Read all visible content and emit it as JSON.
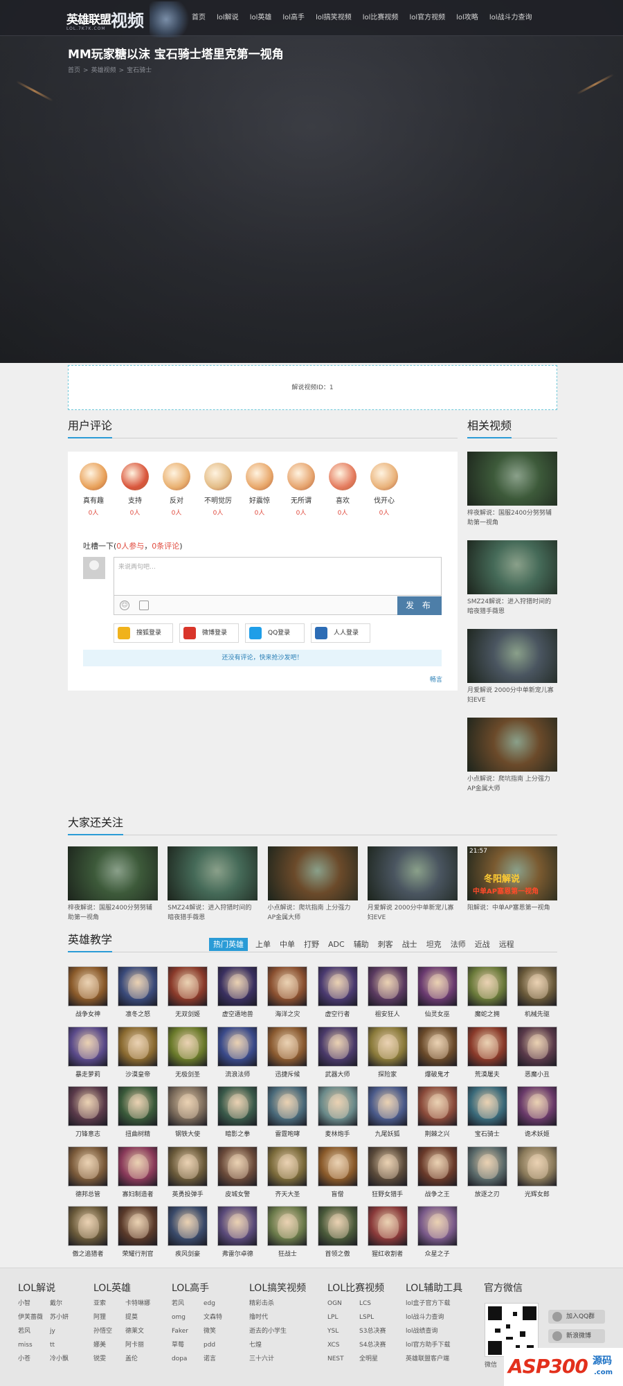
{
  "header": {
    "logo_main": "英雄联盟",
    "logo_video": "视频",
    "logo_sub": "LOL.7K7K.COM",
    "nav": [
      "首页",
      "lol解说",
      "lol英雄",
      "lol高手",
      "lol搞笑视频",
      "lol比赛视频",
      "lol官方视频",
      "lol攻略",
      "lol战斗力查询"
    ]
  },
  "video": {
    "title": "MM玩家糖以沫 宝石骑士塔里克第一视角",
    "breadcrumb": [
      "首页",
      "英雄视频",
      "宝石骑士"
    ],
    "separator": ">",
    "id_text": "解说视频ID：1"
  },
  "comments": {
    "section_title": "用户评论",
    "reactions": [
      {
        "label": "真有趣",
        "count": "0人",
        "color": "#e8a15a"
      },
      {
        "label": "支持",
        "count": "0人",
        "color": "#d9563c"
      },
      {
        "label": "反对",
        "count": "0人",
        "color": "#e9b070"
      },
      {
        "label": "不明觉厉",
        "count": "0人",
        "color": "#e3bc86"
      },
      {
        "label": "好震惊",
        "count": "0人",
        "color": "#e8a76a"
      },
      {
        "label": "无所谓",
        "count": "0人",
        "color": "#e6a46e"
      },
      {
        "label": "喜欢",
        "count": "0人",
        "color": "#e47b5e"
      },
      {
        "label": "伐开心",
        "count": "0人",
        "color": "#e9b27a"
      }
    ],
    "prompt_prefix": "吐槽一下(",
    "participants": "0人参与",
    "comma": "，",
    "count": "0条评论",
    "prompt_suffix": ")",
    "placeholder": "来说两句吧…",
    "publish": "发 布",
    "logins": [
      {
        "label": "搜狐登录",
        "color": "#f0b21c"
      },
      {
        "label": "微博登录",
        "color": "#d9352a"
      },
      {
        "label": "QQ登录",
        "color": "#1f9ee8"
      },
      {
        "label": "人人登录",
        "color": "#2c6cb5"
      }
    ],
    "empty_tip": "还没有评论，快来抢沙发吧！",
    "brand": "畅言"
  },
  "related": {
    "title": "相关视频",
    "items": [
      {
        "caption": "梓夜解说：国服2400分努努辅助第一视角",
        "tone": "#3d5a3a"
      },
      {
        "caption": "SMZ24解说：进入狩猎时间的暗夜猎手薇恩",
        "tone": "#456a58"
      },
      {
        "caption": "月爱解说 2000分中单新宠儿寡妇EVE",
        "tone": "#4a5560"
      },
      {
        "caption": "小点解说：爬坑指南 上分强力AP金属大师",
        "tone": "#6b4a2a"
      }
    ]
  },
  "follow": {
    "title": "大家还关注",
    "items": [
      {
        "caption": "梓夜解说：国服2400分努努辅助第一视角",
        "tone": "#3d5a3a"
      },
      {
        "caption": "SMZ24解说：进入狩猎时间的暗夜猎手薇恩",
        "tone": "#456a58"
      },
      {
        "caption": "小点解说：爬坑指南 上分强力AP金属大师",
        "tone": "#6b4a2a"
      },
      {
        "caption": "月爱解说 2000分中单新宠儿寡妇EVE",
        "tone": "#4a5560"
      },
      {
        "caption": "阳解说：中单AP塞恩第一视角",
        "tone": "#7a5a30",
        "overlay": "冬阳解说",
        "overlay2": "中单AP塞恩第一视角",
        "time": "21:57"
      }
    ]
  },
  "heroes": {
    "title": "英雄教学",
    "tabs": [
      "热门英雄",
      "上单",
      "中单",
      "打野",
      "ADC",
      "辅助",
      "刺客",
      "战士",
      "坦克",
      "法师",
      "近战",
      "远程"
    ],
    "list": [
      {
        "name": "战争女神",
        "c": "#8a5a2a"
      },
      {
        "name": "凛冬之怒",
        "c": "#3a4a7a"
      },
      {
        "name": "无双剑姬",
        "c": "#8a3a2a"
      },
      {
        "name": "虚空遁地兽",
        "c": "#3a3060"
      },
      {
        "name": "海洋之灾",
        "c": "#8a5030"
      },
      {
        "name": "虚空行者",
        "c": "#4a3a70"
      },
      {
        "name": "祖安狂人",
        "c": "#5a3a60"
      },
      {
        "name": "仙灵女巫",
        "c": "#6a3a70"
      },
      {
        "name": "魔蛇之拥",
        "c": "#6a7a3a"
      },
      {
        "name": "机械先驱",
        "c": "#6a5a3a"
      },
      {
        "name": "暴走萝莉",
        "c": "#5a4a8a"
      },
      {
        "name": "沙漠皇帝",
        "c": "#8a6a30"
      },
      {
        "name": "无极剑圣",
        "c": "#6a7a2a"
      },
      {
        "name": "流浪法师",
        "c": "#3a4a8a"
      },
      {
        "name": "迅捷斥候",
        "c": "#8a5a30"
      },
      {
        "name": "武器大师",
        "c": "#4a3a6a"
      },
      {
        "name": "探险家",
        "c": "#8a7a3a"
      },
      {
        "name": "爆破鬼才",
        "c": "#6a4a2a"
      },
      {
        "name": "荒漠屠夫",
        "c": "#8a3a2a"
      },
      {
        "name": "恶魔小丑",
        "c": "#5a3a4a"
      },
      {
        "name": "刀锋意志",
        "c": "#5a3a4a"
      },
      {
        "name": "扭曲树精",
        "c": "#3a5a3a"
      },
      {
        "name": "钢铁大使",
        "c": "#7a6a5a"
      },
      {
        "name": "暗影之拳",
        "c": "#3a5a4a"
      },
      {
        "name": "雷霆咆哮",
        "c": "#4a6a7a"
      },
      {
        "name": "麦林炮手",
        "c": "#6a8a8a"
      },
      {
        "name": "九尾妖狐",
        "c": "#4a5a8a"
      },
      {
        "name": "荆棘之兴",
        "c": "#8a4a3a"
      },
      {
        "name": "宝石骑士",
        "c": "#3a6a7a"
      },
      {
        "name": "诡术妖姬",
        "c": "#6a3a6a"
      },
      {
        "name": "德邦总管",
        "c": "#7a5a3a"
      },
      {
        "name": "寡妇制造者",
        "c": "#8a3a5a"
      },
      {
        "name": "英勇投弹手",
        "c": "#6a5a3a"
      },
      {
        "name": "皮城女警",
        "c": "#6a4a3a"
      },
      {
        "name": "齐天大圣",
        "c": "#7a6a3a"
      },
      {
        "name": "盲僧",
        "c": "#8a5a2a"
      },
      {
        "name": "狂野女猎手",
        "c": "#5a4a3a"
      },
      {
        "name": "战争之王",
        "c": "#6a3a2a"
      },
      {
        "name": "放逐之刃",
        "c": "#5a6a6a"
      },
      {
        "name": "光辉女郎",
        "c": "#8a7a5a"
      },
      {
        "name": "傲之追猎者",
        "c": "#6a5a3a"
      },
      {
        "name": "荣耀行刑官",
        "c": "#5a3a2a"
      },
      {
        "name": "疾风剑豪",
        "c": "#3a4a6a"
      },
      {
        "name": "弗雷尔卓德",
        "c": "#5a4a7a"
      },
      {
        "name": "狂战士",
        "c": "#6a7a4a"
      },
      {
        "name": "首领之傲",
        "c": "#4a5a3a"
      },
      {
        "name": "猩红收割者",
        "c": "#8a3a3a"
      },
      {
        "name": "众星之子",
        "c": "#7a5a8a"
      }
    ]
  },
  "footer": {
    "cols": [
      {
        "title": "LOL解说",
        "links": [
          "小智",
          "戴尔",
          "伊芙蔷薇",
          "苏小妍",
          "若风",
          "jy",
          "miss",
          "tt",
          "小苍",
          "冷小飘"
        ]
      },
      {
        "title": "LOL英雄",
        "links": [
          "亚索",
          "卡特琳娜",
          "阿狸",
          "提莫",
          "孙悟空",
          "德莱文",
          "娜美",
          "阿卡丽",
          "锐雯",
          "盖伦"
        ]
      },
      {
        "title": "LOL高手",
        "links": [
          "若风",
          "edg",
          "omg",
          "文森特",
          "Faker",
          "微笑",
          "草莓",
          "pdd",
          "dopa",
          "诺言"
        ]
      },
      {
        "title": "LOL搞笑视频",
        "links": [
          "精彩击杀",
          "撸时代",
          "逝去的小学生",
          "七煌",
          "三十六计"
        ]
      },
      {
        "title": "LOL比赛视频",
        "links": [
          "OGN",
          "LCS",
          "LPL",
          "LSPL",
          "YSL",
          "S3总决赛",
          "XCS",
          "S4总决赛",
          "NEST",
          "全明星"
        ]
      },
      {
        "title": "LOL辅助工具",
        "links": [
          "lol盒子官方下载",
          "lol战斗力查询",
          "lol战绩查询",
          "lol官方助手下载",
          "英雄联盟客户端"
        ]
      }
    ],
    "wechat_title": "官方微信",
    "qq_group": "加入QQ群",
    "weibo": "新浪微博",
    "wechat_caption": "微信"
  },
  "watermark": {
    "brand": "ASP300",
    "tag": "源码",
    "domain": ".com"
  }
}
